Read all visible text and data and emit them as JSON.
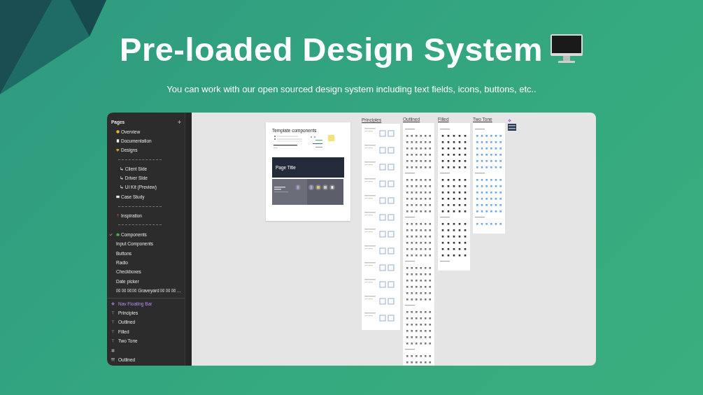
{
  "headline": {
    "title": "Pre-loaded Design System",
    "subtitle": "You can work with our open sourced design system including text fields, icons, buttons, etc.."
  },
  "app": {
    "sidebar": {
      "section_title": "Pages",
      "pages": [
        {
          "kind": "page",
          "label": "Overview",
          "selected": false
        },
        {
          "kind": "page",
          "label": "Documentation",
          "selected": false
        },
        {
          "kind": "page",
          "label": "Designs",
          "selected": false
        },
        {
          "kind": "divider"
        },
        {
          "kind": "subpage",
          "label": "↳ Client Side",
          "selected": false
        },
        {
          "kind": "subpage",
          "label": "↳ Driver Side",
          "selected": false
        },
        {
          "kind": "subpage",
          "label": "↳ UI Kit (Preview)",
          "selected": false
        },
        {
          "kind": "page",
          "label": "Case Study",
          "selected": false
        },
        {
          "kind": "divider"
        },
        {
          "kind": "page",
          "label": "Inspiration",
          "selected": false
        },
        {
          "kind": "divider"
        },
        {
          "kind": "page",
          "label": "Components",
          "selected": true
        },
        {
          "kind": "plain",
          "label": "Input Components",
          "selected": false
        },
        {
          "kind": "plain",
          "label": "Buttons",
          "selected": false
        },
        {
          "kind": "plain",
          "label": "Radio",
          "selected": false
        },
        {
          "kind": "plain",
          "label": "Checkboxes",
          "selected": false
        },
        {
          "kind": "plain",
          "label": "Date picker",
          "selected": false
        },
        {
          "kind": "plain",
          "label": "☒ ☒ ☒ ☒ Graveyard ☒ ☒ ☒ ...",
          "selected": false
        }
      ],
      "layers": [
        {
          "kind": "component",
          "label": "Nav Floating Bar"
        },
        {
          "kind": "text",
          "label": "Principles"
        },
        {
          "kind": "text",
          "label": "Outlined"
        },
        {
          "kind": "text",
          "label": "Filled"
        },
        {
          "kind": "text",
          "label": "Two Tone"
        },
        {
          "kind": "frame"
        },
        {
          "kind": "group",
          "label": "Outlined"
        }
      ]
    },
    "canvas": {
      "template_frame": {
        "title": "Template components",
        "panel_title": "Page Title"
      },
      "frames": [
        {
          "label": "Principles"
        },
        {
          "label": "Outlined"
        },
        {
          "label": "Filled"
        },
        {
          "label": "Two Tone"
        }
      ]
    }
  }
}
